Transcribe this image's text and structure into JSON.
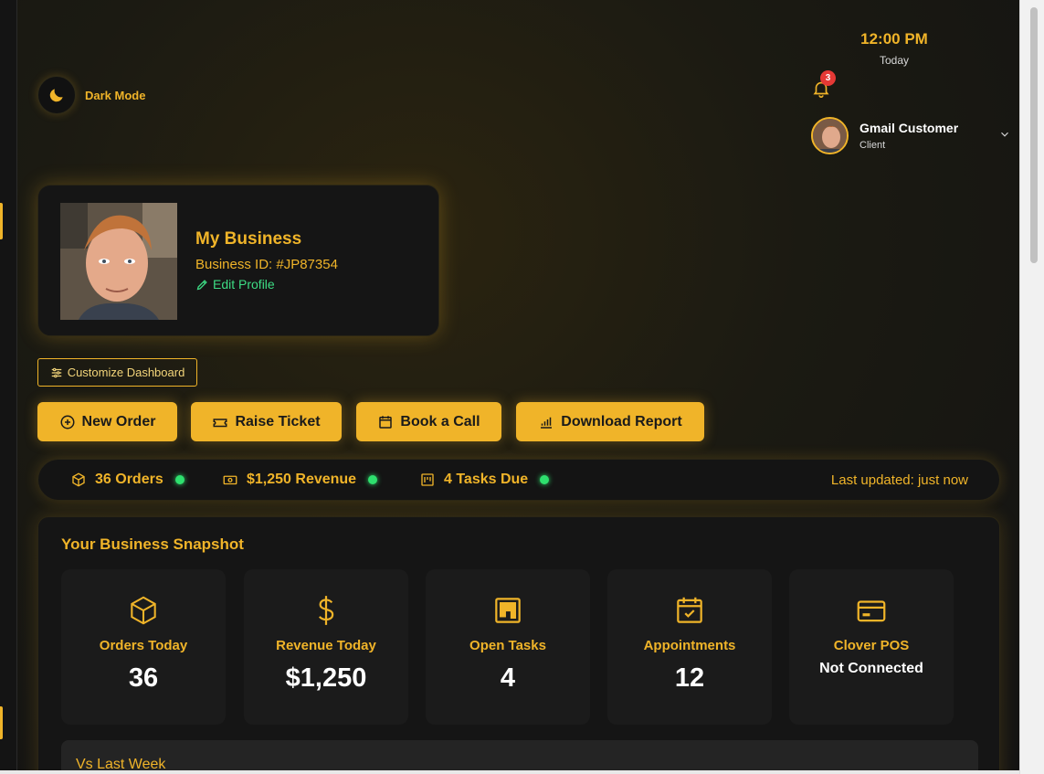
{
  "theme": {
    "accent": "#f0b429",
    "success": "#2ee06e",
    "badge": "#e53935"
  },
  "dark_mode": {
    "label": "Dark Mode",
    "icon": "moon-icon"
  },
  "clock": {
    "time": "12:00 PM",
    "day": "Today"
  },
  "notifications": {
    "count": "3",
    "icon": "bell-icon"
  },
  "user": {
    "name": "Gmail Customer",
    "role": "Client"
  },
  "profile": {
    "business_name": "My Business",
    "business_id": "Business ID: #JP87354",
    "edit_label": "Edit Profile"
  },
  "customize": {
    "label": "Customize Dashboard"
  },
  "actions": [
    {
      "label": "New Order",
      "icon": "plus-circle-icon"
    },
    {
      "label": "Raise Ticket",
      "icon": "ticket-icon"
    },
    {
      "label": "Book a Call",
      "icon": "calendar-icon"
    },
    {
      "label": "Download Report",
      "icon": "bar-chart-icon"
    }
  ],
  "status": {
    "items": [
      {
        "label": "36 Orders",
        "icon": "box-icon"
      },
      {
        "label": "$1,250 Revenue",
        "icon": "cash-icon"
      },
      {
        "label": "4 Tasks Due",
        "icon": "kanban-icon"
      }
    ],
    "last_updated": "Last updated: just now"
  },
  "snapshot": {
    "title": "Your Business Snapshot",
    "cards": [
      {
        "label": "Orders Today",
        "value": "36",
        "icon": "box-icon"
      },
      {
        "label": "Revenue Today",
        "value": "$1,250",
        "icon": "dollar-icon"
      },
      {
        "label": "Open Tasks",
        "value": "4",
        "icon": "kanban-icon"
      },
      {
        "label": "Appointments",
        "value": "12",
        "icon": "calendar-check-icon"
      },
      {
        "label": "Clover POS",
        "value": "Not Connected",
        "icon": "credit-card-icon"
      }
    ],
    "comparison_title": "Vs Last Week"
  }
}
